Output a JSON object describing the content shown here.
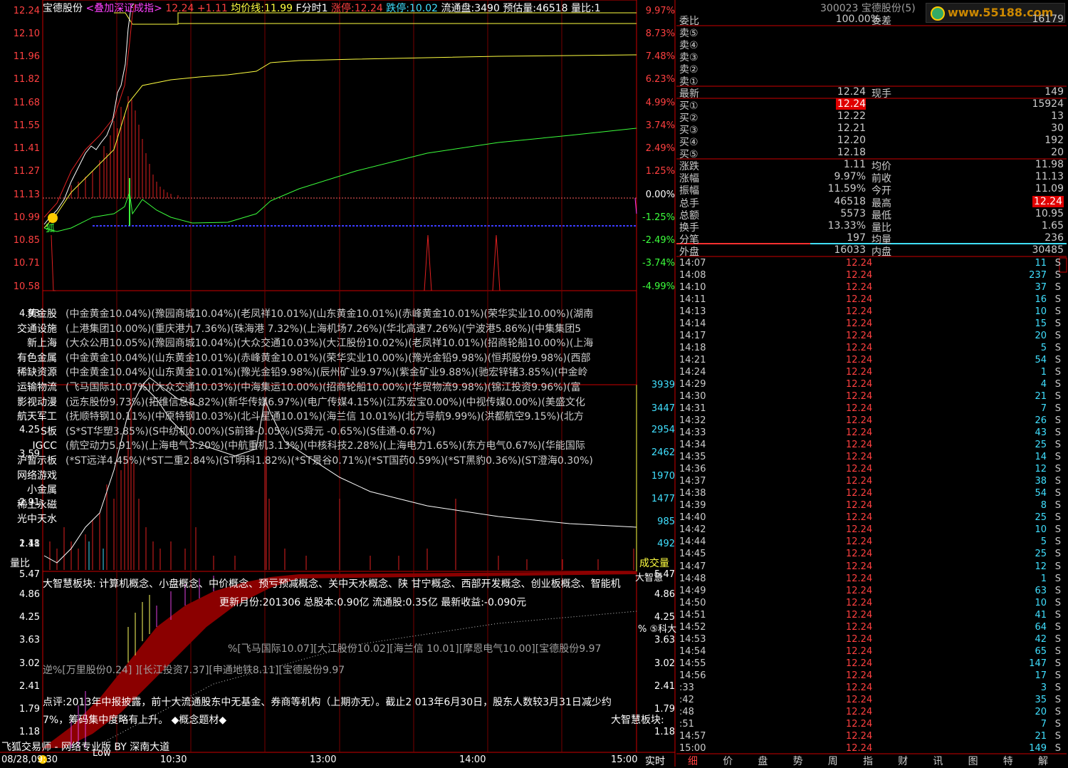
{
  "header": {
    "stock_name": "宝德股份",
    "overlay": "<叠加深证成指>",
    "price": "12.24",
    "change": "+1.11",
    "avg_label": "均价线:",
    "avg_value": "11.99",
    "mode": "F分时1",
    "limit_up_label": "涨停:",
    "limit_up_value": "12.24",
    "limit_down_label": "跌停:",
    "limit_down_value": "10.02",
    "float_label": "流通盘:",
    "float_value": "3490",
    "est_vol_label": "预估量:",
    "est_vol_value": "46518",
    "vol_ratio_label": "量比:",
    "vol_ratio_value": "1"
  },
  "right_header": {
    "code_name": "300023 宝德股份(5)",
    "watermark": "www.55188.com"
  },
  "price_axis_left": [
    "12.24",
    "12.10",
    "11.96",
    "11.82",
    "11.68",
    "11.55",
    "11.41",
    "11.27",
    "11.13",
    "10.99",
    "10.85",
    "10.71",
    "10.58"
  ],
  "price_axis_right": [
    "9.97%",
    "8.73%",
    "7.48%",
    "6.23%",
    "4.99%",
    "3.74%",
    "2.49%",
    "1.25%",
    "0.00%",
    "-1.25%",
    "-2.49%",
    "-3.74%",
    "-4.99%"
  ],
  "vol_axis_left": [
    "4.93",
    "4.25",
    "3.59",
    "2.91",
    "2.41",
    "1.18"
  ],
  "vol_axis_right": [
    "3939",
    "3447",
    "2954",
    "2462",
    "1970",
    "1477",
    "985",
    "492"
  ],
  "vol_ratio_label": "量比",
  "vol_label": "成交量",
  "lower_axis_left": [
    "5.47",
    "4.86",
    "4.25",
    "3.63",
    "3.02",
    "2.41",
    "1.79",
    "1.18"
  ],
  "lower_axis_right": [
    "5.47",
    "4.86",
    "4.25",
    "3.63",
    "3.02",
    "2.41",
    "1.79",
    "1.18"
  ],
  "markers": {
    "fox": "狐"
  },
  "concepts": [
    {
      "name": "黄金股",
      "text": "(中金黄金10.04%)(豫园商城10.04%)(老凤祥10.01%)(山东黄金10.01%)(赤峰黄金10.01%)(荣华实业10.00%)(湖南"
    },
    {
      "name": "交通设施",
      "text": "(上港集团10.00%)(重庆港九7.36%)(珠海港  7.32%)(上海机场7.26%)(华北高速7.26%)(宁波港5.86%)(中集集团5"
    },
    {
      "name": "新上海",
      "text": "(大众公用10.05%)(豫园商城10.04%)(大众交通10.03%)(大江股份10.02%)(老凤祥10.01%)(招商轮船10.00%)(上海"
    },
    {
      "name": "有色金属",
      "text": "(中金黄金10.04%)(山东黄金10.01%)(赤峰黄金10.01%)(荣华实业10.00%)(豫光金铅9.98%)(恒邦股份9.98%)(西部"
    },
    {
      "name": "稀缺资源",
      "text": "(中金黄金10.04%)(山东黄金10.01%)(豫光金铅9.98%)(辰州矿业9.97%)(紫金矿业9.88%)(驰宏锌锗3.85%)(中金岭"
    },
    {
      "name": "运输物流",
      "text": "(飞马国际10.07%)(大众交通10.03%)(中海集运10.00%)(招商轮船10.00%)(华贸物流9.98%)(锦江投资9.96%)(富"
    },
    {
      "name": "影视动漫",
      "text": "(远东股份9.73%)(拓维信息8.82%)(新华传媒6.97%)(电广传媒4.15%)(江苏宏宝0.00%)(中视传媒0.00%)(美盛文化"
    },
    {
      "name": "航天军工",
      "text": "(抚顺特钢10.11%)(中原特钢10.03%)(北斗星通10.01%)(海兰信  10.01%)(北方导航9.99%)(洪都航空9.15%)(北方"
    },
    {
      "name": "S板",
      "text": "(S*ST华塑3.85%)(S中纺机0.00%)(S前锋-0.05%)(S舜元   -0.65%)(S佳通-0.67%)"
    },
    {
      "name": "IGCC",
      "text": "(航空动力5.91%)(上海电气3.20%)(中航重机3.13%)(中核科技2.28%)(上海电力1.65%)(东方电气0.67%)(华能国际"
    },
    {
      "name": "沪暂示板",
      "text": "(*ST远洋4.45%)(*ST二重2.84%)(ST明科1.82%)(*ST景谷0.71%)(*ST国药0.59%)(*ST黑豹0.36%)(ST澄海0.30%)"
    },
    {
      "name": "网络游戏",
      "text": ""
    },
    {
      "name": "小金属",
      "text": ""
    },
    {
      "name": "稀土永磁",
      "text": ""
    },
    {
      "name": "光中天水",
      "text": ""
    }
  ],
  "lower": {
    "sector_line": "大智慧板块: 计算机概念、小盘概念、中价概念、预亏预减概念、关中天水概念、陕  甘宁概念、西部开发概念、创业板概念、智能机",
    "update_line": "更新月份:201306    总股本:0.90亿    流通股:0.35亿    最新收益:-0.090元",
    "rank_line1": "%[飞马国际10.07][大江股份10.02][海兰信  10.01][摩恩电气10.00][宝德股份9.97",
    "rank_line2": "逆%[万里股份0.24]      ][长江投资7.37][申通地铁8.11][宝德股份9.97",
    "comment1": "点评:2013年中报披露，前十大流通股东中无基金、券商等机构（上期亦无）。截止2        013年6月30日，股东人数较3月31日减少约",
    "comment2": "7%，筹码集中度略有上升。   ◆概念题材◆",
    "dzh": "大智慧板块:",
    "topright_a": "大智慧",
    "topright_b": "%  ⑤科大",
    "brand": "飞狐交易师 - 网络专业版 BY 深南大道"
  },
  "time_axis": [
    "08/28,09:30",
    "10:30",
    "13:00",
    "14:00",
    "15:00"
  ],
  "time_axis_extra": "Low",
  "realtime_label": "实时",
  "weibi": {
    "k": "委比",
    "v1": "100.00%",
    "k2": "委差",
    "v2": "16179"
  },
  "sells": [
    {
      "k": "卖⑤",
      "v1": "",
      "v2": ""
    },
    {
      "k": "卖④",
      "v1": "",
      "v2": ""
    },
    {
      "k": "卖③",
      "v1": "",
      "v2": ""
    },
    {
      "k": "卖②",
      "v1": "",
      "v2": ""
    },
    {
      "k": "卖①",
      "v1": "",
      "v2": ""
    }
  ],
  "latest": {
    "k": "最新",
    "v1": "12.24",
    "k2": "现手",
    "v2": "149"
  },
  "buys": [
    {
      "k": "买①",
      "v1": "12.24",
      "v2": "15924"
    },
    {
      "k": "买②",
      "v1": "12.22",
      "v2": "13"
    },
    {
      "k": "买③",
      "v1": "12.21",
      "v2": "30"
    },
    {
      "k": "买④",
      "v1": "12.20",
      "v2": "192"
    },
    {
      "k": "买⑤",
      "v1": "12.18",
      "v2": "20"
    }
  ],
  "stats": [
    {
      "k": "涨跌",
      "v1": "1.11",
      "k2": "均价",
      "v2": "11.98"
    },
    {
      "k": "涨幅",
      "v1": "9.97%",
      "k2": "前收",
      "v2": "11.13"
    },
    {
      "k": "振幅",
      "v1": "11.59%",
      "k2": "今开",
      "v2": "11.09"
    },
    {
      "k": "总手",
      "v1": "46518",
      "k2": "最高",
      "v2": "12.24"
    },
    {
      "k": "总额",
      "v1": "5573",
      "k2": "最低",
      "v2": "10.95"
    },
    {
      "k": "换手",
      "v1": "13.33%",
      "k2": "量比",
      "v2": "1.65"
    },
    {
      "k": "分笔",
      "v1": "197",
      "k2": "均量",
      "v2": "236"
    },
    {
      "k": "外盘",
      "v1": "16033",
      "k2": "内盘",
      "v2": "30485"
    }
  ],
  "ticks": [
    {
      "t": "14:07",
      "p": "12.24",
      "v": "11",
      "s": "S"
    },
    {
      "t": "14:08",
      "p": "12.24",
      "v": "237",
      "s": "S"
    },
    {
      "t": "14:10",
      "p": "12.24",
      "v": "37",
      "s": "S"
    },
    {
      "t": "14:11",
      "p": "12.24",
      "v": "16",
      "s": "S"
    },
    {
      "t": "14:13",
      "p": "12.24",
      "v": "10",
      "s": "S"
    },
    {
      "t": "14:14",
      "p": "12.24",
      "v": "15",
      "s": "S"
    },
    {
      "t": "14:17",
      "p": "12.24",
      "v": "20",
      "s": "S"
    },
    {
      "t": "14:18",
      "p": "12.24",
      "v": "5",
      "s": "S"
    },
    {
      "t": "14:21",
      "p": "12.24",
      "v": "54",
      "s": "S"
    },
    {
      "t": "14:24",
      "p": "12.24",
      "v": "1",
      "s": "S"
    },
    {
      "t": "14:29",
      "p": "12.24",
      "v": "4",
      "s": "S"
    },
    {
      "t": "14:30",
      "p": "12.24",
      "v": "21",
      "s": "S"
    },
    {
      "t": "14:31",
      "p": "12.24",
      "v": "7",
      "s": "S"
    },
    {
      "t": "14:32",
      "p": "12.24",
      "v": "26",
      "s": "S"
    },
    {
      "t": "14:33",
      "p": "12.24",
      "v": "43",
      "s": "S"
    },
    {
      "t": "14:34",
      "p": "12.24",
      "v": "25",
      "s": "S"
    },
    {
      "t": "14:35",
      "p": "12.24",
      "v": "14",
      "s": "S"
    },
    {
      "t": "14:36",
      "p": "12.24",
      "v": "12",
      "s": "S"
    },
    {
      "t": "14:37",
      "p": "12.24",
      "v": "38",
      "s": "S"
    },
    {
      "t": "14:38",
      "p": "12.24",
      "v": "54",
      "s": "S"
    },
    {
      "t": "14:39",
      "p": "12.24",
      "v": "8",
      "s": "S"
    },
    {
      "t": "14:40",
      "p": "12.24",
      "v": "25",
      "s": "S"
    },
    {
      "t": "14:42",
      "p": "12.24",
      "v": "10",
      "s": "S"
    },
    {
      "t": "14:44",
      "p": "12.24",
      "v": "5",
      "s": "S"
    },
    {
      "t": "14:45",
      "p": "12.24",
      "v": "25",
      "s": "S"
    },
    {
      "t": "14:47",
      "p": "12.24",
      "v": "12",
      "s": "S"
    },
    {
      "t": "14:48",
      "p": "12.24",
      "v": "1",
      "s": "S"
    },
    {
      "t": "14:49",
      "p": "12.24",
      "v": "63",
      "s": "S"
    },
    {
      "t": "14:50",
      "p": "12.24",
      "v": "10",
      "s": "S"
    },
    {
      "t": "14:51",
      "p": "12.24",
      "v": "41",
      "s": "S"
    },
    {
      "t": "14:52",
      "p": "12.24",
      "v": "64",
      "s": "S"
    },
    {
      "t": "14:53",
      "p": "12.24",
      "v": "42",
      "s": "S"
    },
    {
      "t": "14:54",
      "p": "12.24",
      "v": "65",
      "s": "S"
    },
    {
      "t": "14:55",
      "p": "12.24",
      "v": "147",
      "s": "S"
    },
    {
      "t": "14:56",
      "p": "12.24",
      "v": "17",
      "s": "S"
    },
    {
      "t": ":33",
      "p": "12.24",
      "v": "3",
      "s": "S"
    },
    {
      "t": ":42",
      "p": "12.24",
      "v": "35",
      "s": "S"
    },
    {
      "t": ":48",
      "p": "12.24",
      "v": "20",
      "s": "S"
    },
    {
      "t": ":51",
      "p": "12.24",
      "v": "7",
      "s": "S"
    },
    {
      "t": "14:57",
      "p": "12.24",
      "v": "21",
      "s": "S"
    },
    {
      "t": "15:00",
      "p": "12.24",
      "v": "149",
      "s": "S"
    }
  ],
  "bottom_tabs": [
    "细",
    "价",
    "盘",
    "势",
    "周",
    "指",
    "财",
    "讯",
    "图",
    "特",
    "解"
  ],
  "colors": {
    "bg": "#000000",
    "grid": "#c00000",
    "up": "#ff4040",
    "price_line": "#ffffff",
    "avg_line": "#ffff40",
    "index_line": "#3cff3c",
    "base_line": "#3c3cff"
  }
}
